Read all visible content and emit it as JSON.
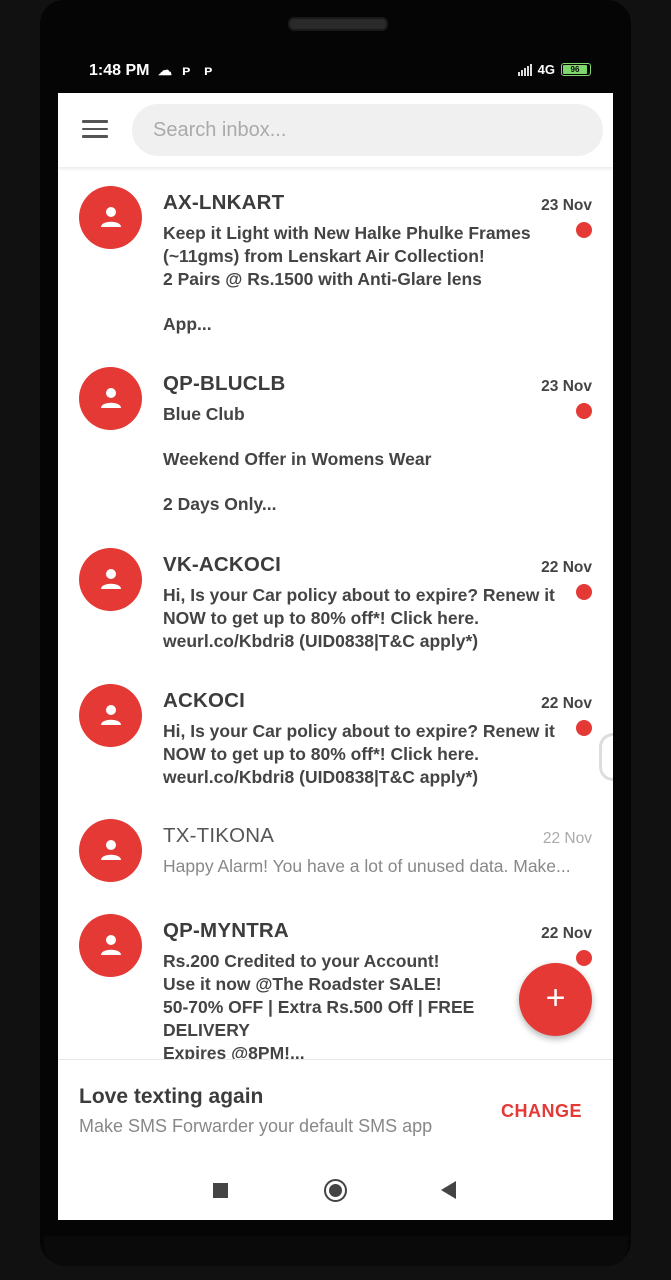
{
  "status_bar": {
    "time": "1:48 PM",
    "network": "4G",
    "battery": "96",
    "icons": [
      "cloud-icon",
      "p-icon",
      "p-icon"
    ]
  },
  "search": {
    "placeholder": "Search inbox..."
  },
  "messages": [
    {
      "sender": "AX-LNKART",
      "date": "23 Nov",
      "unread": true,
      "lines": [
        "Keep it Light with New Halke Phulke Frames (~11gms) from Lenskart Air Collection!",
        "2 Pairs @ Rs.1500 with Anti-Glare lens",
        "",
        "App..."
      ]
    },
    {
      "sender": "QP-BLUCLB",
      "date": "23 Nov",
      "unread": true,
      "lines": [
        "Blue Club",
        "",
        "Weekend Offer in Womens Wear",
        "",
        "2 Days Only..."
      ]
    },
    {
      "sender": "VK-ACKOCI",
      "date": "22 Nov",
      "unread": true,
      "lines": [
        "Hi, Is your Car policy about to expire? Renew it NOW to get up to 80% off*! Click here. weurl.co/Kbdri8 (UID0838|T&C apply*)"
      ]
    },
    {
      "sender": "ACKOCI",
      "date": "22 Nov",
      "unread": true,
      "lines": [
        "Hi, Is your Car policy about to expire? Renew it NOW to get up to 80% off*! Click here. weurl.co/Kbdri8 (UID0838|T&C apply*)"
      ]
    },
    {
      "sender": "TX-TIKONA",
      "date": "22 Nov",
      "unread": false,
      "lines": [
        "Happy Alarm! You have a lot of unused data. Make..."
      ]
    },
    {
      "sender": "QP-MYNTRA",
      "date": "22 Nov",
      "unread": true,
      "lines": [
        "Rs.200 Credited to your Account!",
        "Use it now @The Roadster SALE!",
        "50-70% OFF | Extra Rs.500 Off | FREE DELIVERY",
        "Expires @8PM!..."
      ]
    }
  ],
  "fab": {
    "label": "+"
  },
  "banner": {
    "title": "Love texting again",
    "subtitle": "Make SMS Forwarder your default SMS app",
    "action": "CHANGE"
  },
  "colors": {
    "accent": "#e53935"
  }
}
